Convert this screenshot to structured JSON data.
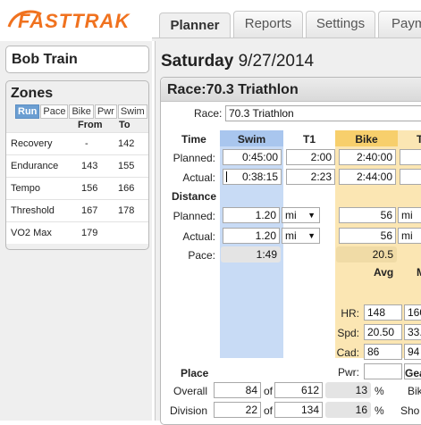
{
  "brand": {
    "logo_text": "FastTrak",
    "accent": "#f0721f"
  },
  "tabs": [
    {
      "label": "Planner",
      "active": true
    },
    {
      "label": "Reports",
      "active": false
    },
    {
      "label": "Settings",
      "active": false
    },
    {
      "label": "Paym",
      "active": false
    }
  ],
  "athlete": {
    "name": "Bob Train"
  },
  "zones": {
    "title": "Zones",
    "sport_tabs": [
      {
        "label": "Run",
        "active": true
      },
      {
        "label": "Pace",
        "active": false
      },
      {
        "label": "Bike",
        "active": false
      },
      {
        "label": "Pwr",
        "active": false
      },
      {
        "label": "Swim",
        "active": false
      }
    ],
    "columns": [
      "From",
      "To"
    ],
    "rows": [
      {
        "name": "Recovery",
        "from": "-",
        "to": "142"
      },
      {
        "name": "Endurance",
        "from": "143",
        "to": "155"
      },
      {
        "name": "Tempo",
        "from": "156",
        "to": "166"
      },
      {
        "name": "Threshold",
        "from": "167",
        "to": "178"
      },
      {
        "name": "VO2 Max",
        "from": "179",
        "to": ""
      }
    ]
  },
  "date": {
    "weekday": "Saturday",
    "date": "9/27/2014"
  },
  "race": {
    "header": "Race:70.3 Triathlon",
    "race_label": "Race:",
    "race_value": "70.3 Triathlon",
    "time_label": "Time",
    "distance_label": "Distance",
    "planned_label": "Planned:",
    "actual_label": "Actual:",
    "pace_label": "Pace:",
    "columns": {
      "swim": "Swim",
      "t1": "T1",
      "bike": "Bike"
    },
    "time": {
      "planned": {
        "swim": "0:45:00",
        "t1": "2:00",
        "bike": "2:40:00"
      },
      "actual": {
        "swim": "0:38:15",
        "t1": "2:23",
        "bike": "2:44:00"
      }
    },
    "distance": {
      "planned": {
        "swim": "1.20",
        "swim_unit": "mi",
        "bike": "56",
        "bike_unit": "mi"
      },
      "actual": {
        "swim": "1.20",
        "swim_unit": "mi",
        "bike": "56",
        "bike_unit": "mi"
      }
    },
    "pace": {
      "swim": "1:49",
      "bike": "20.5"
    },
    "metrics": {
      "avg_label": "Avg",
      "max_label": "M",
      "rows": [
        {
          "label": "HR:",
          "avg": "148",
          "max": "160"
        },
        {
          "label": "Spd:",
          "avg": "20.50",
          "max": "33."
        },
        {
          "label": "Cad:",
          "avg": "86",
          "max": "94"
        },
        {
          "label": "Pwr:",
          "avg": "",
          "max": ""
        }
      ]
    },
    "place": {
      "title": "Place",
      "of_label": "of",
      "pct_label": "%",
      "rows": [
        {
          "label": "Overall",
          "place": "84",
          "total": "612",
          "pct": "13"
        },
        {
          "label": "Division",
          "place": "22",
          "total": "134",
          "pct": "16"
        }
      ]
    },
    "gear": {
      "title": "Gea",
      "bike_label": "Bik",
      "shoe_label": "Sho"
    }
  }
}
